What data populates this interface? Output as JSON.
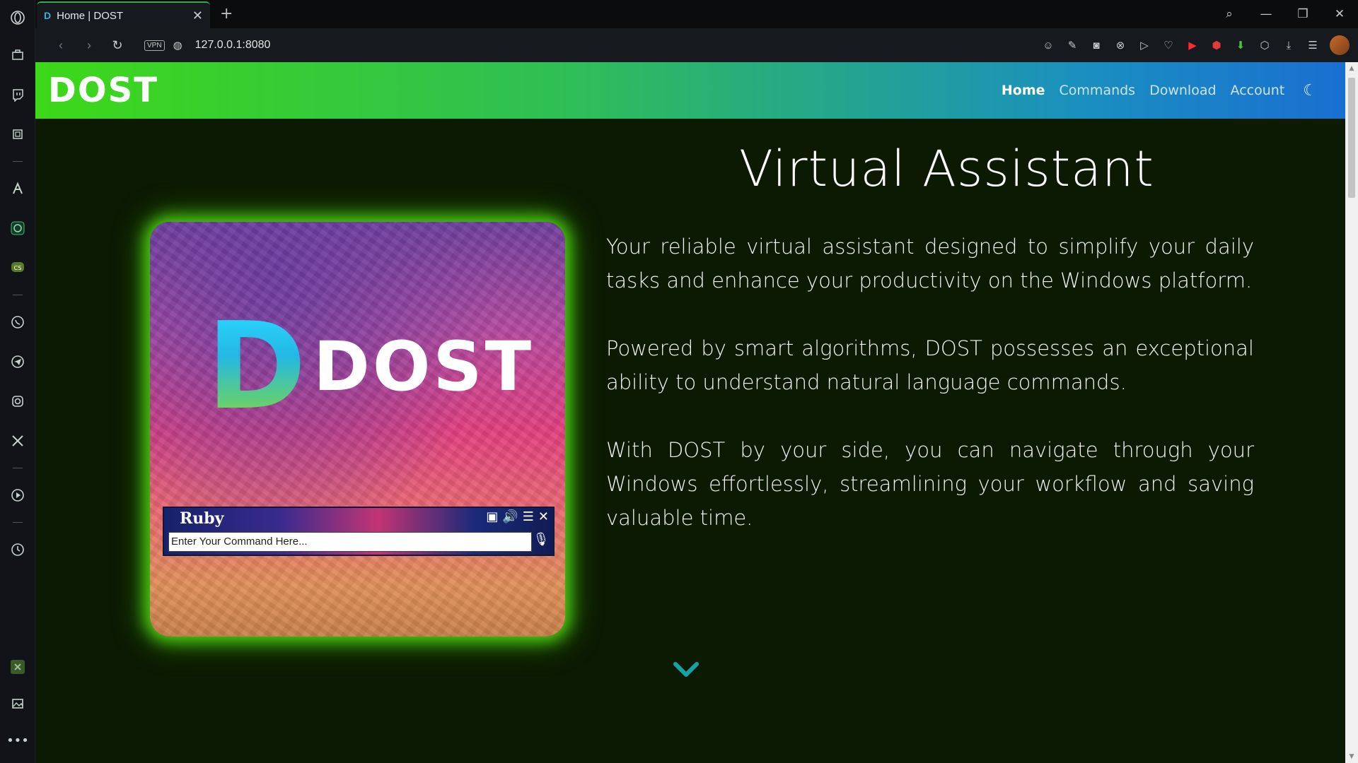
{
  "browser": {
    "tab_title": "Home | DOST",
    "tab_favicon": "D",
    "url": "127.0.0.1:8080",
    "vpn_label": "VPN"
  },
  "sidebar_icons": [
    "opera-logo-icon",
    "briefcase-icon",
    "twitch-icon",
    "cpu-icon",
    "aria-icon",
    "chatgpt-icon",
    "cs-icon",
    "whatsapp-icon",
    "telegram-icon",
    "instagram-icon",
    "x-icon",
    "player-icon",
    "history-icon",
    "extension-icon",
    "gallery-icon",
    "more-icon"
  ],
  "site": {
    "logo": "DOST",
    "nav": [
      {
        "label": "Home",
        "active": true
      },
      {
        "label": "Commands",
        "active": false
      },
      {
        "label": "Download",
        "active": false
      },
      {
        "label": "Account",
        "active": false
      }
    ],
    "theme_toggle_icon": "moon-icon"
  },
  "hero": {
    "title": "Virtual Assistant",
    "paragraphs": [
      "Your reliable virtual assistant designed to simplify your daily tasks and enhance your productivity on the Windows platform.",
      "Powered by smart algorithms, DOST possesses an exceptional ability to understand natural language commands.",
      "With DOST by your side, you can navigate through your Windows effortlessly, streamlining your workflow and saving valuable time."
    ],
    "card_logo_word": "DOST",
    "assistant_window": {
      "name": "Ruby",
      "input_placeholder": "Enter Your Command Here..."
    }
  },
  "colors": {
    "accent": "#4cd312",
    "page_bg": "#0c1a03",
    "chevron": "#16a3a3"
  }
}
